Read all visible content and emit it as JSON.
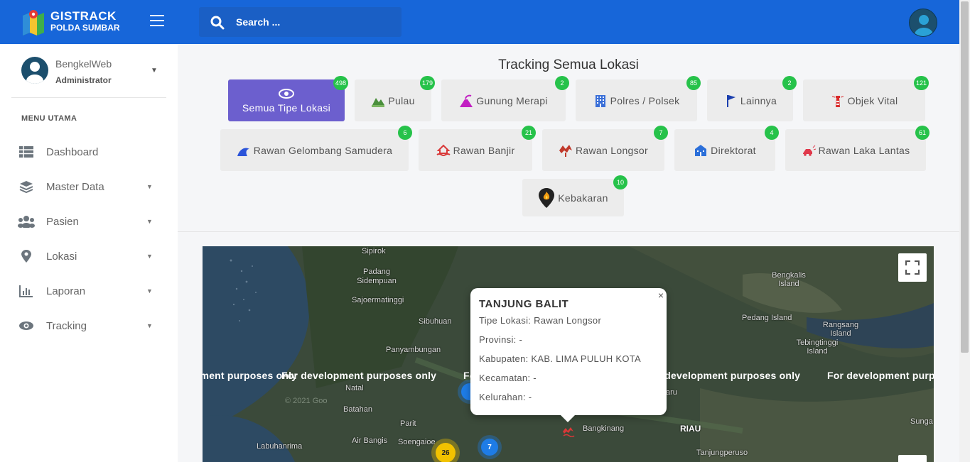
{
  "brand": {
    "title": "GISTRACK",
    "subtitle": "POLDA SUMBAR"
  },
  "search": {
    "placeholder": "Search ..."
  },
  "user": {
    "name": "BengkelWeb",
    "role": "Administrator"
  },
  "menu": {
    "title": "MENU UTAMA",
    "items": [
      {
        "label": "Dashboard",
        "icon": "table-icon",
        "has_caret": false
      },
      {
        "label": "Master Data",
        "icon": "layers-icon",
        "has_caret": true
      },
      {
        "label": "Pasien",
        "icon": "users-icon",
        "has_caret": true
      },
      {
        "label": "Lokasi",
        "icon": "map-marker-icon",
        "has_caret": true
      },
      {
        "label": "Laporan",
        "icon": "bar-chart-icon",
        "has_caret": true
      },
      {
        "label": "Tracking",
        "icon": "eye-icon",
        "has_caret": true
      }
    ]
  },
  "main": {
    "title": "Tracking Semua Lokasi",
    "filters": [
      {
        "label": "Semua Tipe Lokasi",
        "count": "498",
        "icon": "eye-icon",
        "active": true
      },
      {
        "label": "Pulau",
        "count": "179",
        "icon": "island-icon"
      },
      {
        "label": "Gunung Merapi",
        "count": "2",
        "icon": "volcano-icon"
      },
      {
        "label": "Polres / Polsek",
        "count": "85",
        "icon": "building-icon"
      },
      {
        "label": "Lainnya",
        "count": "2",
        "icon": "flag-icon"
      },
      {
        "label": "Objek Vital",
        "count": "121",
        "icon": "lighthouse-icon"
      },
      {
        "label": "Rawan Gelombang Samudera",
        "count": "6",
        "icon": "wave-icon"
      },
      {
        "label": "Rawan Banjir",
        "count": "21",
        "icon": "flood-icon"
      },
      {
        "label": "Rawan Longsor",
        "count": "7",
        "icon": "landslide-icon"
      },
      {
        "label": "Direktorat",
        "count": "4",
        "icon": "office-icon"
      },
      {
        "label": "Rawan Laka Lantas",
        "count": "61",
        "icon": "car-crash-icon"
      },
      {
        "label": "Kebakaran",
        "count": "10",
        "icon": "fire-icon"
      }
    ]
  },
  "map": {
    "watermark": "For development purposes only",
    "labels": [
      "Sipirok",
      "Padang Sidempuan",
      "Sajoermatinggi",
      "Sibuhuan",
      "Panyambungan",
      "Natal",
      "Batahan",
      "Parit",
      "Air Bangis",
      "Soengaioe",
      "Labuhanrima",
      "Bengkalis Island",
      "Bengkalis",
      "Pedang Island",
      "Rangsang Island",
      "Tebingtinggi Island",
      "Bangkinang",
      "RIAU",
      "Tanjungperuso",
      "aru",
      "Sunga"
    ],
    "clusters": [
      {
        "count": "26",
        "color": "#f2c200"
      },
      {
        "count": "7",
        "color": "#1e7ce6"
      }
    ],
    "popup": {
      "title": "TANJUNG BALIT",
      "tipe": "Tipe Lokasi: Rawan Longsor",
      "provinsi": "Provinsi: -",
      "kabupaten": "Kabupaten: KAB. LIMA PULUH KOTA",
      "kecamatan": "Kecamatan: -",
      "kelurahan": "Kelurahan: -",
      "close": "×"
    },
    "copyright": "© 2021 Goo"
  }
}
